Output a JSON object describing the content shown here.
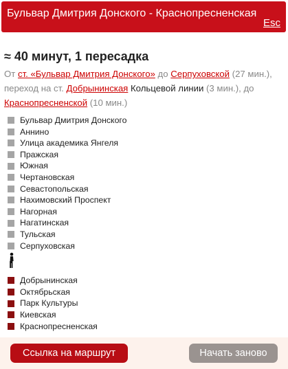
{
  "header": {
    "title": "Бульвар Дмитрия Донского - Краснопресненская",
    "esc_label": "Esc"
  },
  "summary": "≈ 40 минут, 1 пересадка",
  "description": {
    "t1": "От ",
    "l1": "ст. «Бульвар Дмитрия Донского»",
    "t2": " до ",
    "l2": "Серпуховской",
    "t3": " (27 мин.), переход на ст. ",
    "l3": "Добрынинская",
    "d1": " Кольцевой линии",
    "t4": " (3 мин.), до ",
    "l4": "Краснопресненской",
    "t5": " (10 мин.)"
  },
  "segments": [
    {
      "line_color": "#a5a5a5",
      "stations": [
        "Бульвар Дмитрия Донского",
        "Аннино",
        "Улица академика Янгеля",
        "Пражская",
        "Южная",
        "Чертановская",
        "Севастопольская",
        "Нахимовский Проспект",
        "Нагорная",
        "Нагатинская",
        "Тульская",
        "Серпуховская"
      ]
    },
    {
      "line_color": "#8b0f10",
      "stations": [
        "Добрынинская",
        "Октябрьская",
        "Парк Культуры",
        "Киевская",
        "Краснопресненская"
      ]
    }
  ],
  "footer": {
    "link_button": "Ссылка на маршрут",
    "reset_button": "Начать заново"
  },
  "icons": {
    "transfer": "walking-person-icon"
  }
}
